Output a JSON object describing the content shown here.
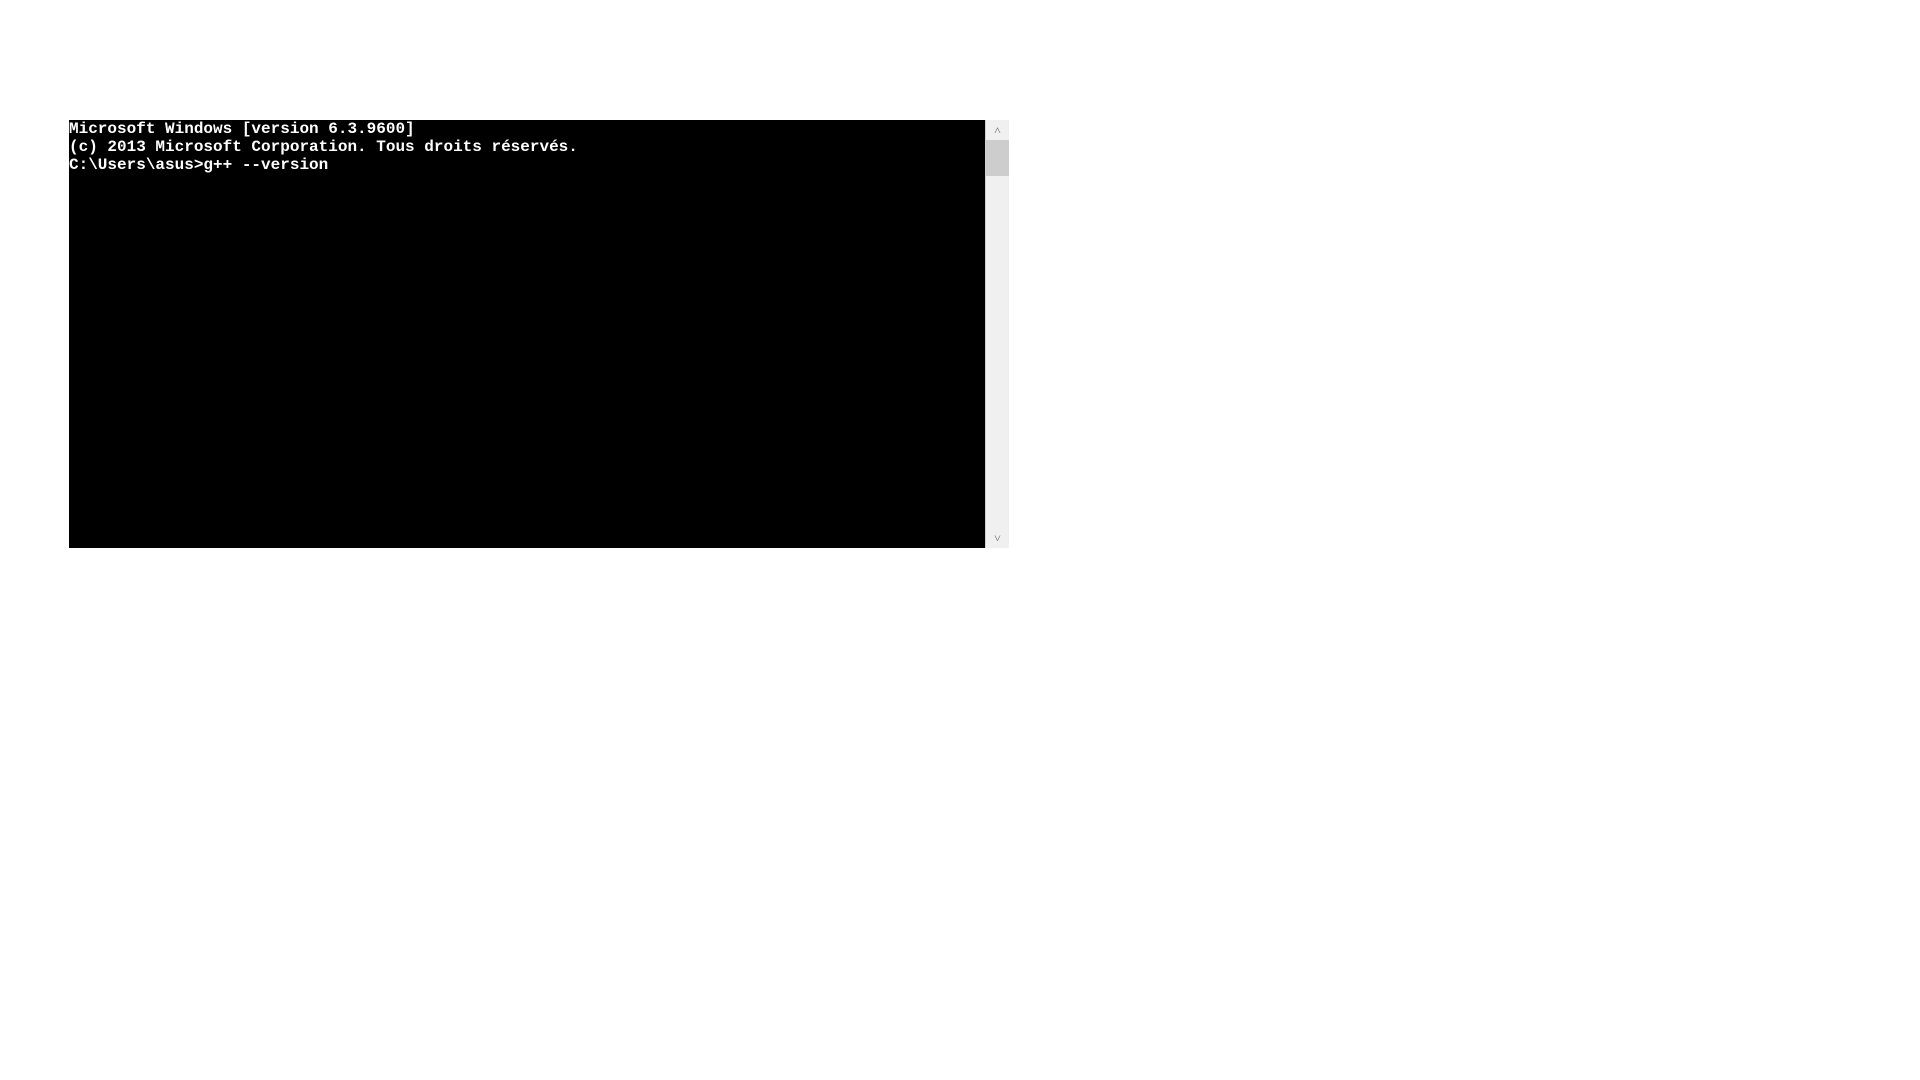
{
  "terminal": {
    "line1": "Microsoft Windows [version 6.3.9600]",
    "line2": "(c) 2013 Microsoft Corporation. Tous droits réservés.",
    "blank": "",
    "prompt": "C:\\Users\\asus>",
    "command": "g++ --version"
  },
  "scrollbar": {
    "up": "˄",
    "down": "˅"
  }
}
